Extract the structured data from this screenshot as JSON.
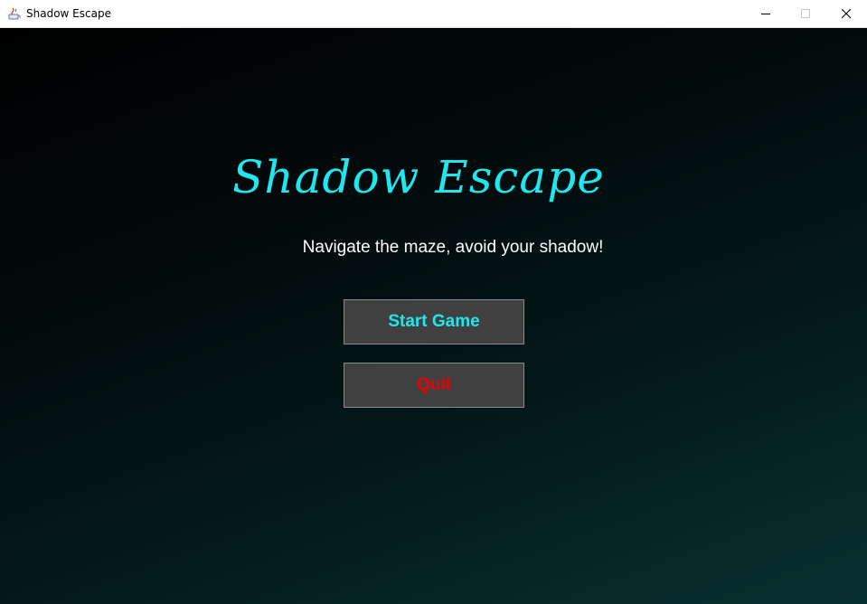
{
  "window": {
    "title": "Shadow Escape",
    "icon": "java-app-icon",
    "controls": [
      "minimize-icon",
      "maximize-icon",
      "close-icon"
    ]
  },
  "game": {
    "title": "Shadow Escape",
    "subtitle": "Navigate the maze, avoid your shadow!",
    "buttons": {
      "start_label": "Start Game",
      "quit_label": "Quit"
    }
  },
  "colors": {
    "title": "#1ee8ee",
    "start_text": "#1ee8ee",
    "quit_text": "#ee0000",
    "button_bg": "#404040",
    "background_dark": "#000000",
    "background_teal": "#073030"
  }
}
